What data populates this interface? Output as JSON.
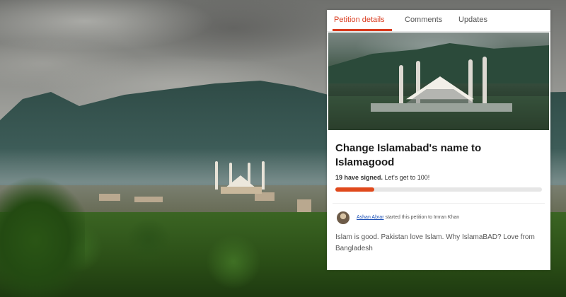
{
  "tabs": [
    {
      "label": "Petition details",
      "active": true
    },
    {
      "label": "Comments",
      "active": false
    },
    {
      "label": "Updates",
      "active": false
    }
  ],
  "petition": {
    "title": "Change Islamabad's name to Islamagood",
    "signed_count": "19 have signed.",
    "goal_text": "Let's get to 100!",
    "progress_percent": 19,
    "starter_name": "Ashan Abrar",
    "starter_text": "started this petition to Imran Khan",
    "body": "Islam is good. Pakistan love Islam. Why IslamaBAD? Love from Bangladesh"
  },
  "colors": {
    "accent": "#d93a1d",
    "progress": "#e0491c",
    "link": "#1a4fb5"
  }
}
